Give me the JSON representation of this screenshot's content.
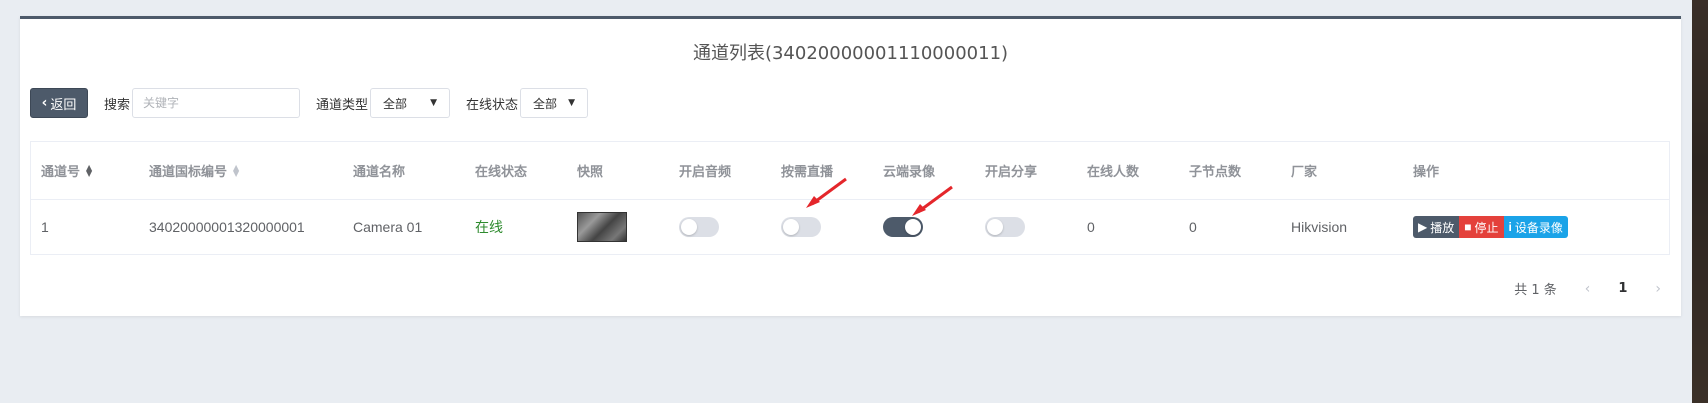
{
  "page": {
    "title": "通道列表(34020000001110000011)"
  },
  "toolbar": {
    "back_label": "返回",
    "search_label": "搜索",
    "search_placeholder": "关键字",
    "channel_type_label": "通道类型",
    "channel_type_value": "全部",
    "online_status_label": "在线状态",
    "online_status_value": "全部"
  },
  "table": {
    "columns": [
      "通道号",
      "通道国标编号",
      "通道名称",
      "在线状态",
      "快照",
      "开启音频",
      "按需直播",
      "云端录像",
      "开启分享",
      "在线人数",
      "子节点数",
      "厂家",
      "操作"
    ],
    "rows": [
      {
        "channel_no": "1",
        "gb_id": "34020000001320000001",
        "name": "Camera 01",
        "status": "在线",
        "audio": false,
        "on_demand": false,
        "cloud_record": true,
        "share": false,
        "online_users": "0",
        "child_nodes": "0",
        "vendor": "Hikvision",
        "actions": {
          "play": "播放",
          "stop": "停止",
          "record": "设备录像"
        }
      }
    ]
  },
  "pagination": {
    "total_text": "共 1 条",
    "current_page": "1"
  },
  "colors": {
    "primary": "#4d5a6a",
    "danger": "#e4413b",
    "info": "#1aa3e8",
    "online": "#2e8b2e",
    "annotation_arrow": "#e4262b"
  }
}
